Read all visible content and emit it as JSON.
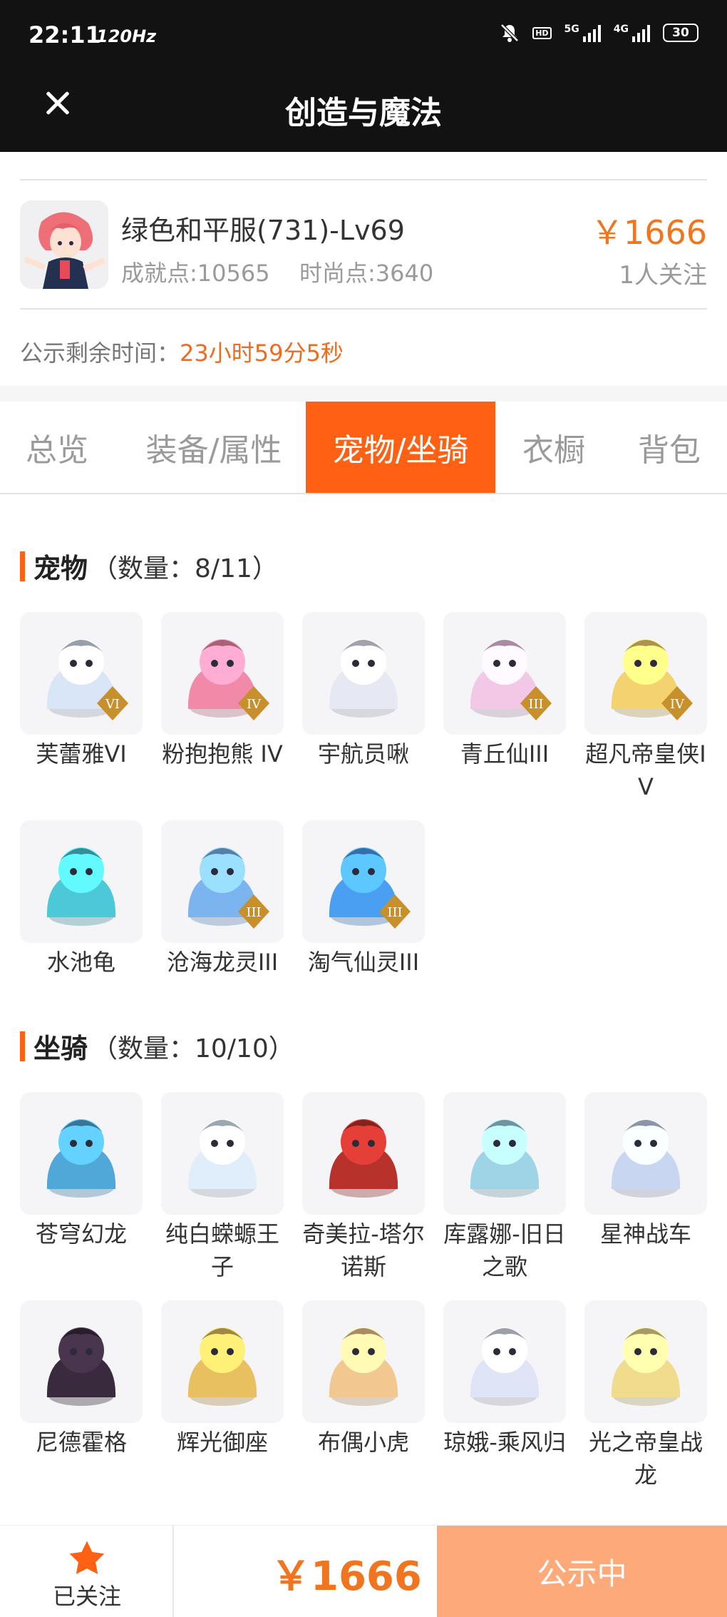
{
  "status_bar": {
    "time": "22:11",
    "refresh": "120Hz",
    "net_5g": "5G",
    "net_4g": "4G",
    "hd": "HD",
    "battery": "30"
  },
  "header": {
    "title": "创造与魔法"
  },
  "listing": {
    "name": "绿色和平服(731)-Lv69",
    "achievement": "成就点:10565",
    "fashion": "时尚点:3640",
    "price": "￥1666",
    "followers": "1人关注",
    "timer_label": "公示剩余时间：",
    "timer_value": "23小时59分5秒"
  },
  "tabs": [
    {
      "label": "总览"
    },
    {
      "label": "装备/属性"
    },
    {
      "label": "宠物/坐骑",
      "active": true
    },
    {
      "label": "衣橱"
    },
    {
      "label": "背包"
    }
  ],
  "pets": {
    "title": "宠物",
    "count": "（数量：8/11）",
    "items": [
      {
        "name": "芙蕾雅VI",
        "icon": "angel-girl-icon",
        "color": "#d8e6f7",
        "badge": "VI"
      },
      {
        "name": "粉抱抱熊 IV",
        "icon": "pink-bear-icon",
        "color": "#f08aa8",
        "badge": "IV"
      },
      {
        "name": "宇航员啾",
        "icon": "astronaut-icon",
        "color": "#e6e8f4",
        "badge": ""
      },
      {
        "name": "青丘仙III",
        "icon": "fox-fairy-icon",
        "color": "#f2c8e6",
        "badge": "III"
      },
      {
        "name": "超凡帝皇侠IV",
        "icon": "golden-knight-icon",
        "color": "#f4d270",
        "badge": "IV"
      },
      {
        "name": "水池龟",
        "icon": "turtle-icon",
        "color": "#4dc8d8",
        "badge": ""
      },
      {
        "name": "沧海龙灵III",
        "icon": "sea-dragon-boy-icon",
        "color": "#7cb4f0",
        "badge": "III"
      },
      {
        "name": "淘气仙灵III",
        "icon": "blue-puppy-icon",
        "color": "#4a9ff2",
        "badge": "III"
      }
    ]
  },
  "mounts": {
    "title": "坐骑",
    "count": "（数量：10/10）",
    "items": [
      {
        "name": "苍穹幻龙",
        "icon": "sky-dragon-icon",
        "color": "#4fa8d8"
      },
      {
        "name": "纯白蝾螈王子",
        "icon": "axolotl-icon",
        "color": "#dfeefa"
      },
      {
        "name": "奇美拉-塔尔诺斯",
        "icon": "chimera-icon",
        "color": "#b8322c"
      },
      {
        "name": "库露娜-旧日之歌",
        "icon": "songstress-icon",
        "color": "#9fd4e6"
      },
      {
        "name": "星神战车",
        "icon": "star-chariot-icon",
        "color": "#c8d6f2"
      },
      {
        "name": "尼德霍格",
        "icon": "dark-dragon-icon",
        "color": "#3a2a3e"
      },
      {
        "name": "辉光御座",
        "icon": "throne-icon",
        "color": "#e8c060"
      },
      {
        "name": "布偶小虎",
        "icon": "tiger-doll-icon",
        "color": "#f2c890"
      },
      {
        "name": "琼娥-乘风归",
        "icon": "moon-lady-icon",
        "color": "#dfe4f6"
      },
      {
        "name": "光之帝皇战龙",
        "icon": "light-dragon-icon",
        "color": "#f0dc8c"
      }
    ]
  },
  "bottom": {
    "fav_label": "已关注",
    "price": "￥1666",
    "status": "公示中"
  }
}
